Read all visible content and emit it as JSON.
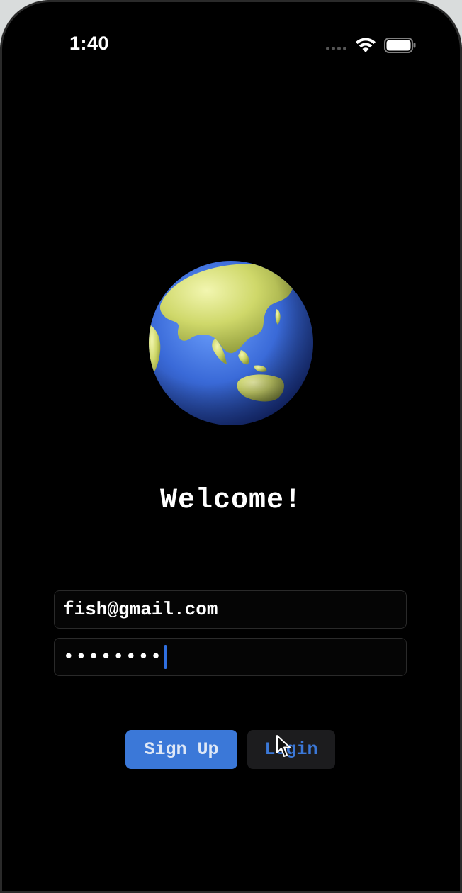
{
  "status_bar": {
    "time": "1:40",
    "signal_icon": "signal-dots-icon",
    "wifi_icon": "wifi-icon",
    "battery_icon": "battery-icon"
  },
  "hero": {
    "icon": "earth-globe-icon",
    "title": "Welcome!"
  },
  "form": {
    "email_value": "fish@gmail.com",
    "password_value": "••••••••",
    "caret_color": "#2f6fe0"
  },
  "actions": {
    "signup_label": "Sign Up",
    "login_label": "Login",
    "accent_color": "#3b78d8"
  }
}
